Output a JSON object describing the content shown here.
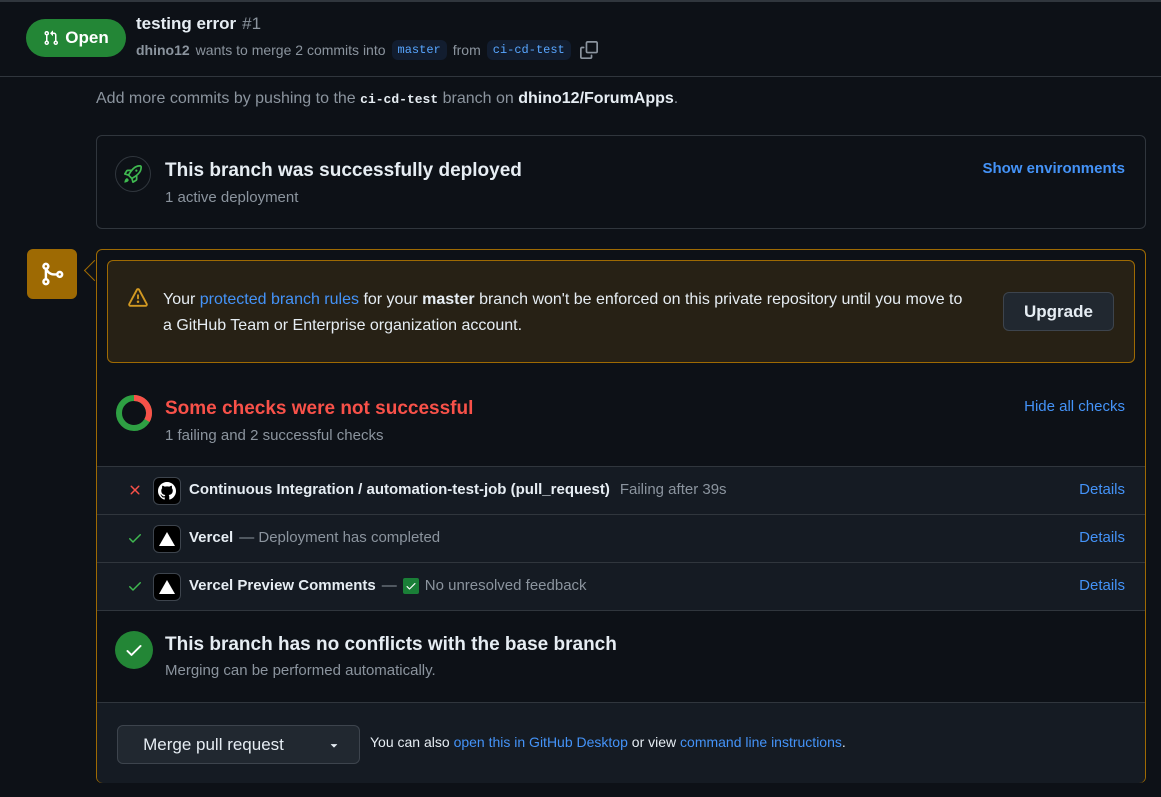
{
  "header": {
    "state": "Open",
    "title": "testing error",
    "number": "#1",
    "author": "dhino12",
    "meta_middle": "wants to merge 2 commits into",
    "base_branch": "master",
    "meta_from": "from",
    "head_branch": "ci-cd-test"
  },
  "hint": {
    "prefix": "Add more commits by pushing to the",
    "branch": "ci-cd-test",
    "middle": "branch on",
    "repo": "dhino12/ForumApps",
    "suffix": "."
  },
  "deployment": {
    "title": "This branch was successfully deployed",
    "subtitle": "1 active deployment",
    "action": "Show environments"
  },
  "warning": {
    "prefix": "Your",
    "link": "protected branch rules",
    "middle": "for your",
    "branch": "master",
    "suffix": "branch won't be enforced on this private repository until you move to a GitHub Team or Enterprise organization account.",
    "button": "Upgrade"
  },
  "checks": {
    "title": "Some checks were not successful",
    "subtitle": "1 failing and 2 successful checks",
    "toggle": "Hide all checks",
    "failing": 1,
    "successful": 2,
    "items": [
      {
        "status": "failure",
        "name": "Continuous Integration / automation-test-job (pull_request)",
        "description": "Failing after 39s",
        "action": "Details",
        "logo": "github-icon"
      },
      {
        "status": "success",
        "name": "Vercel",
        "description": "— Deployment has completed",
        "action": "Details",
        "logo": "vercel-icon"
      },
      {
        "status": "success",
        "name": "Vercel Preview Comments",
        "dash": "—",
        "description": "No unresolved feedback",
        "action": "Details",
        "logo": "vercel-icon"
      }
    ]
  },
  "conflicts": {
    "title": "This branch has no conflicts with the base branch",
    "subtitle": "Merging can be performed automatically."
  },
  "merge": {
    "button": "Merge pull request",
    "note_prefix": "You can also",
    "note_link1": "open this in GitHub Desktop",
    "note_middle": "or view",
    "note_link2": "command line instructions",
    "note_suffix": "."
  },
  "colors": {
    "background": "#0d1117",
    "open_green": "#238636",
    "link_blue": "#4493f8",
    "failure_red": "#f85149",
    "warning_amber": "#9e6a03"
  }
}
